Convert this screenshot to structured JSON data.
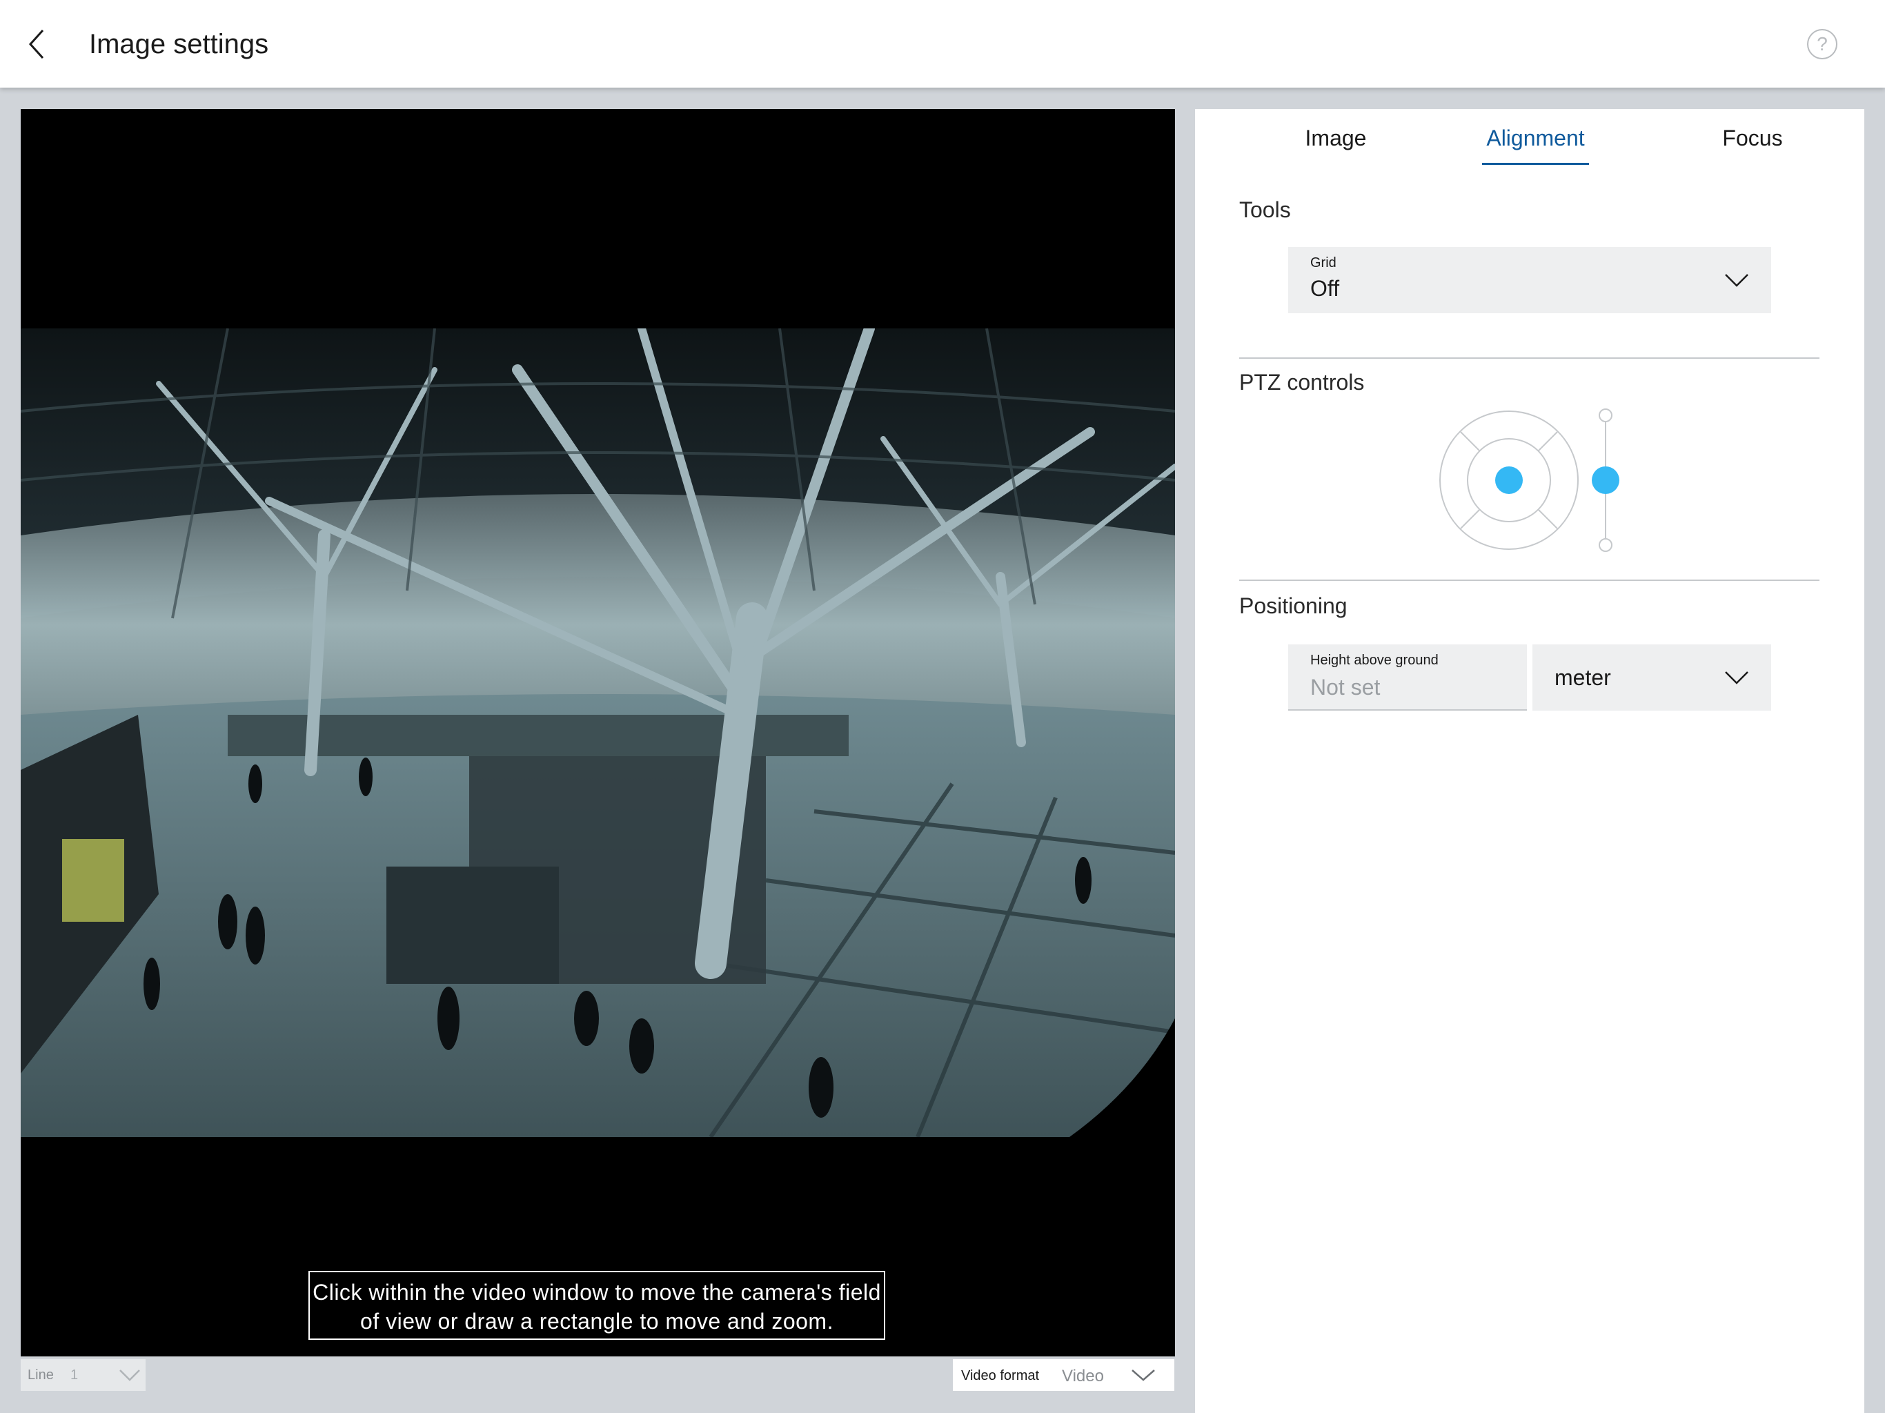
{
  "header": {
    "title": "Image settings",
    "help_label": "?",
    "back_icon": "chevron-left-icon",
    "help_icon": "help-circle-icon"
  },
  "video": {
    "hint": "Click within the video window to move the camera's field of view or draw a rectangle to move and zoom.",
    "line_label": "Line",
    "line_value": "1",
    "format_label": "Video format",
    "format_value": "Video"
  },
  "tabs": [
    {
      "label": "Image",
      "active": false
    },
    {
      "label": "Alignment",
      "active": true
    },
    {
      "label": "Focus",
      "active": false
    }
  ],
  "tools": {
    "title": "Tools",
    "grid_label": "Grid",
    "grid_value": "Off"
  },
  "ptz": {
    "title": "PTZ controls"
  },
  "positioning": {
    "title": "Positioning",
    "height_label": "Height above ground",
    "height_placeholder": "Not set",
    "height_value": "",
    "unit_value": "meter"
  },
  "colors": {
    "accent": "#0f5a9c",
    "ptz_handle": "#34b8f4",
    "background": "#d0d4d9"
  }
}
